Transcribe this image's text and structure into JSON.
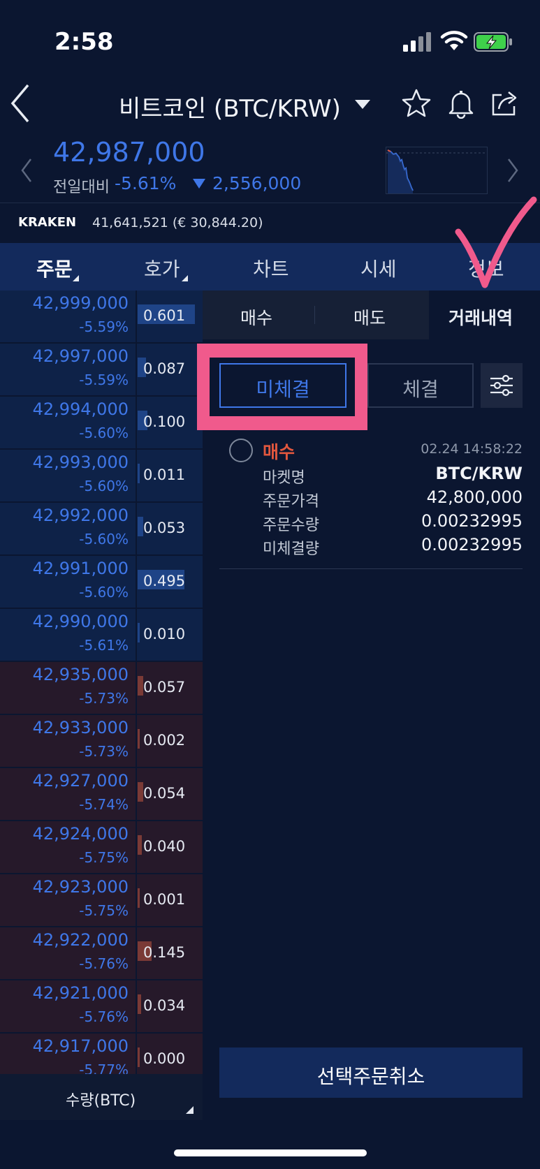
{
  "status": {
    "time": "2:58"
  },
  "header": {
    "title": "비트코인 (BTC/KRW)"
  },
  "ticker": {
    "price": "42,987,000",
    "change_label": "전일대비",
    "change_pct": "-5.61%",
    "change_amount": "2,556,000"
  },
  "kraken": {
    "label": "KRAKEN",
    "value": "41,641,521 (€ 30,844.20)"
  },
  "tabs": [
    "주문",
    "호가",
    "차트",
    "시세",
    "정보"
  ],
  "orderbook": {
    "sell_rows": [
      {
        "price": "42,999,000",
        "pct": "-5.59%",
        "qty": "0.601",
        "depth": 0.95
      },
      {
        "price": "42,997,000",
        "pct": "-5.59%",
        "qty": "0.087",
        "depth": 0.14
      },
      {
        "price": "42,994,000",
        "pct": "-5.60%",
        "qty": "0.100",
        "depth": 0.16
      },
      {
        "price": "42,993,000",
        "pct": "-5.60%",
        "qty": "0.011",
        "depth": 0.03
      },
      {
        "price": "42,992,000",
        "pct": "-5.60%",
        "qty": "0.053",
        "depth": 0.09
      },
      {
        "price": "42,991,000",
        "pct": "-5.60%",
        "qty": "0.495",
        "depth": 0.78
      },
      {
        "price": "42,990,000",
        "pct": "-5.61%",
        "qty": "0.010",
        "depth": 0.02
      }
    ],
    "buy_rows": [
      {
        "price": "42,935,000",
        "pct": "-5.73%",
        "qty": "0.057",
        "depth": 0.09
      },
      {
        "price": "42,933,000",
        "pct": "-5.73%",
        "qty": "0.002",
        "depth": 0.01
      },
      {
        "price": "42,927,000",
        "pct": "-5.74%",
        "qty": "0.054",
        "depth": 0.09
      },
      {
        "price": "42,924,000",
        "pct": "-5.75%",
        "qty": "0.040",
        "depth": 0.07
      },
      {
        "price": "42,923,000",
        "pct": "-5.75%",
        "qty": "0.001",
        "depth": 0.0
      },
      {
        "price": "42,922,000",
        "pct": "-5.76%",
        "qty": "0.145",
        "depth": 0.23
      },
      {
        "price": "42,921,000",
        "pct": "-5.76%",
        "qty": "0.034",
        "depth": 0.06
      },
      {
        "price": "42,917,000",
        "pct": "-5.77%",
        "qty": "0.000",
        "depth": 0.0
      }
    ],
    "footer_label": "수량(BTC)"
  },
  "panel": {
    "tabs": [
      "매수",
      "매도",
      "거래내역"
    ],
    "filters": {
      "unfilled": "미체결",
      "filled": "체결"
    },
    "order": {
      "side": "매수",
      "time": "02.24 14:58:22",
      "fields": [
        {
          "label": "마켓명",
          "value": "BTC/KRW"
        },
        {
          "label": "주문가격",
          "value": "42,800,000"
        },
        {
          "label": "주문수량",
          "value": "0.00232995"
        },
        {
          "label": "미체결량",
          "value": "0.00232995"
        }
      ]
    },
    "cancel_label": "선택주문취소"
  },
  "colors": {
    "accent": "#3f77e8",
    "sell_side": "#e2573e",
    "highlight": "#f05a8c"
  }
}
